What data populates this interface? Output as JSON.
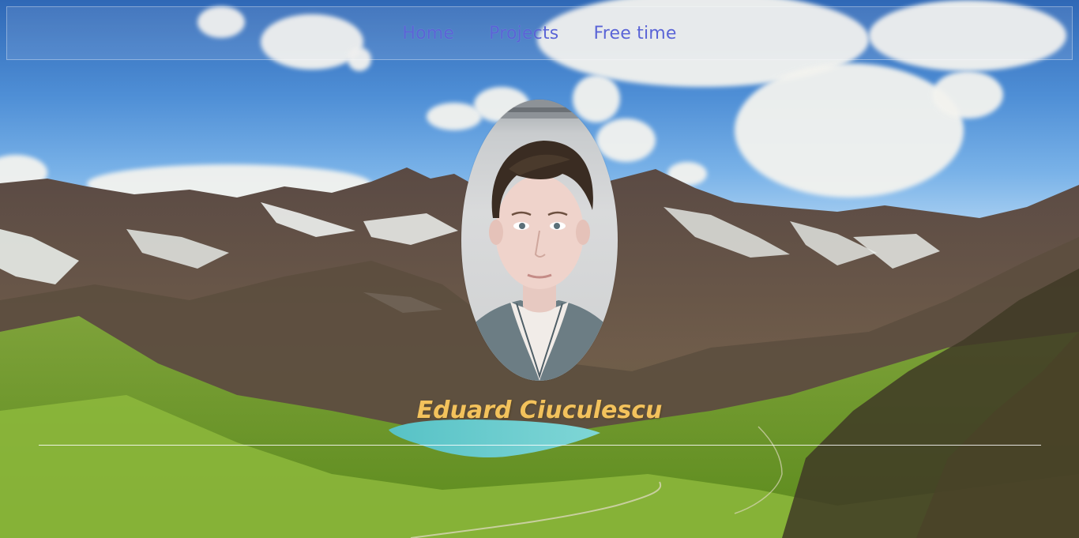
{
  "nav": {
    "items": [
      {
        "label": "Home"
      },
      {
        "label": "Projects"
      },
      {
        "label": "Free time"
      }
    ]
  },
  "profile": {
    "name": "Eduard Ciuculescu"
  },
  "colors": {
    "nav_link": "#5a64d6",
    "name_text": "#f3c25c",
    "rule": "#ffffff"
  }
}
